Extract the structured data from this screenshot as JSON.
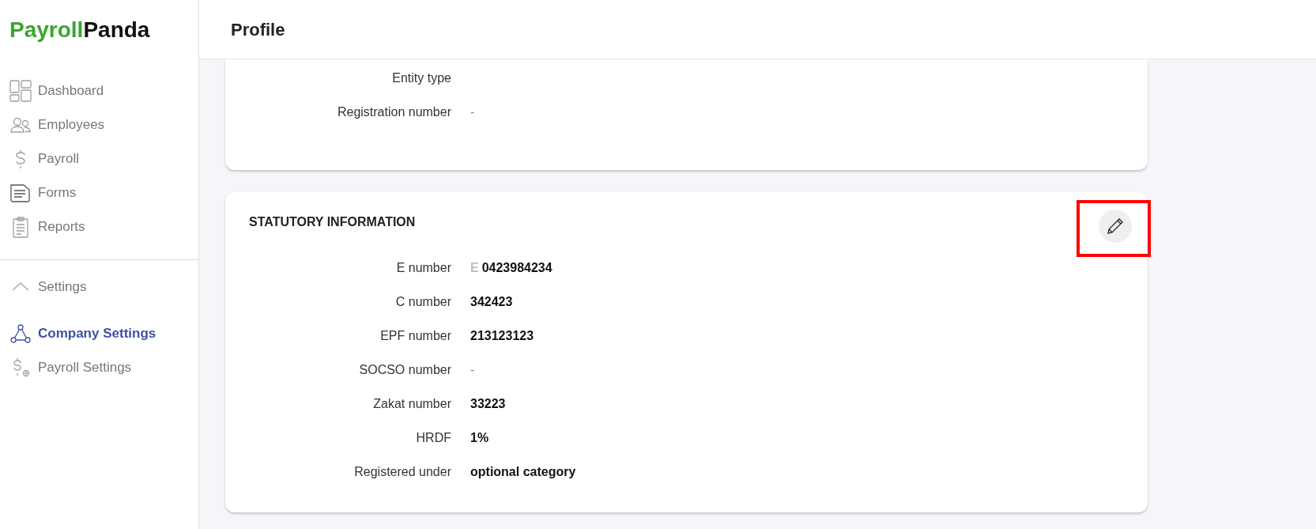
{
  "brand": {
    "first": "Payroll",
    "second": "Panda"
  },
  "sidebar": {
    "items": [
      {
        "label": "Dashboard",
        "kind": "dashboard",
        "selected": false
      },
      {
        "label": "Employees",
        "kind": "people",
        "selected": false
      },
      {
        "label": "Payroll",
        "kind": "dollar",
        "selected": false
      },
      {
        "label": "Forms",
        "kind": "form",
        "selected": false
      },
      {
        "label": "Reports",
        "kind": "clipboard",
        "selected": false
      }
    ],
    "settings": {
      "label": "Settings",
      "expanded": true,
      "children": [
        {
          "label": "Company Settings",
          "kind": "network",
          "selected": true
        },
        {
          "label": "Payroll Settings",
          "kind": "dollargear",
          "selected": false
        }
      ]
    }
  },
  "header": {
    "title": "Profile"
  },
  "company_card": {
    "rows": [
      {
        "label": "Entity type"
      },
      {
        "label": "Registration number",
        "value": "-",
        "empty": true
      }
    ]
  },
  "statutory_card": {
    "title": "STATUTORY INFORMATION",
    "highlighted_edit": true,
    "rows": [
      {
        "label": "E number",
        "prefix": "E",
        "value": "0423984234",
        "empty": false
      },
      {
        "label": "C number",
        "value": "342423",
        "empty": false
      },
      {
        "label": "EPF number",
        "value": "213123123",
        "empty": false
      },
      {
        "label": "SOCSO number",
        "value": "-",
        "empty": true
      },
      {
        "label": "Zakat number",
        "value": "33223",
        "empty": false
      },
      {
        "label": "HRDF",
        "value": "1%",
        "empty": false
      },
      {
        "label": "Registered under",
        "value": "optional category",
        "empty": false
      }
    ]
  }
}
